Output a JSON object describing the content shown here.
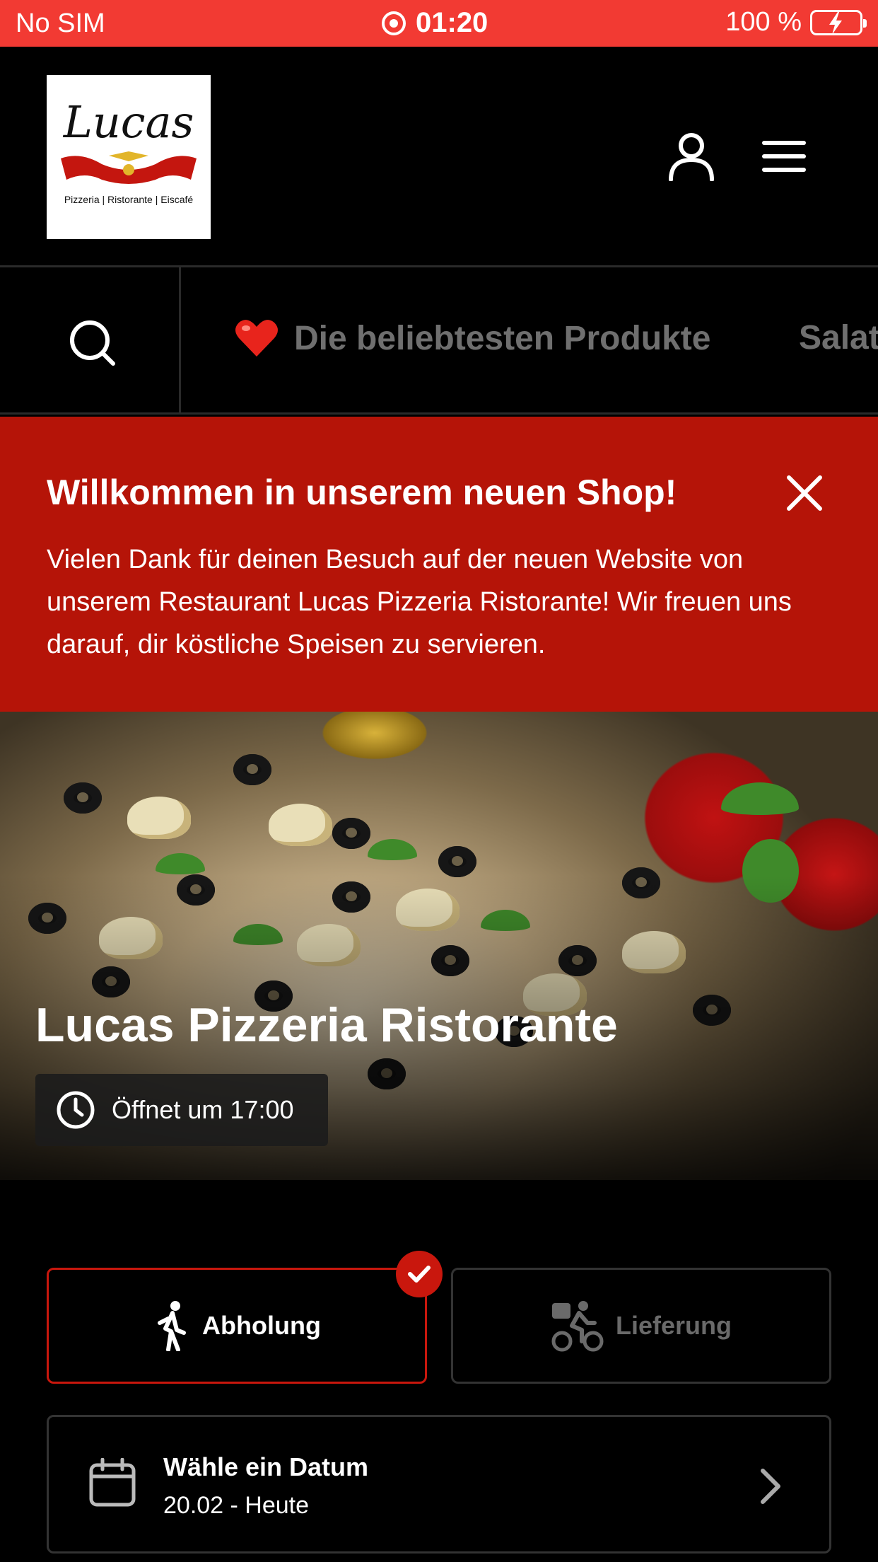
{
  "status_bar": {
    "carrier": "No SIM",
    "time": "01:20",
    "battery": "100 %"
  },
  "header": {
    "logo": {
      "script": "Lucas",
      "tagline": "Pizzeria | Ristorante | Eiscafé"
    },
    "icons": [
      "user-icon",
      "menu-icon"
    ]
  },
  "category_nav": {
    "items": [
      {
        "label": "Die beliebtesten Produkte",
        "icon": "heart-icon"
      },
      {
        "label": "Salat"
      }
    ]
  },
  "welcome": {
    "title": "Willkommen in unserem neuen Shop!",
    "body": "Vielen Dank für deinen Besuch auf der neuen Website von unserem Restaurant Lucas Pizzeria Ristorante! Wir freuen uns darauf, dir köstliche Speisen zu servieren."
  },
  "hero": {
    "title": "Lucas Pizzeria Ristorante",
    "opening": "Öffnet um 17:00"
  },
  "order_mode": {
    "pickup_label": "Abholung",
    "delivery_label": "Lieferung",
    "selected": "pickup"
  },
  "date_picker": {
    "label": "Wähle ein Datum",
    "value": "20.02 - Heute"
  },
  "colors": {
    "status_bar": "#f23a33",
    "banner": "#b51408",
    "accent": "#c9170d"
  }
}
